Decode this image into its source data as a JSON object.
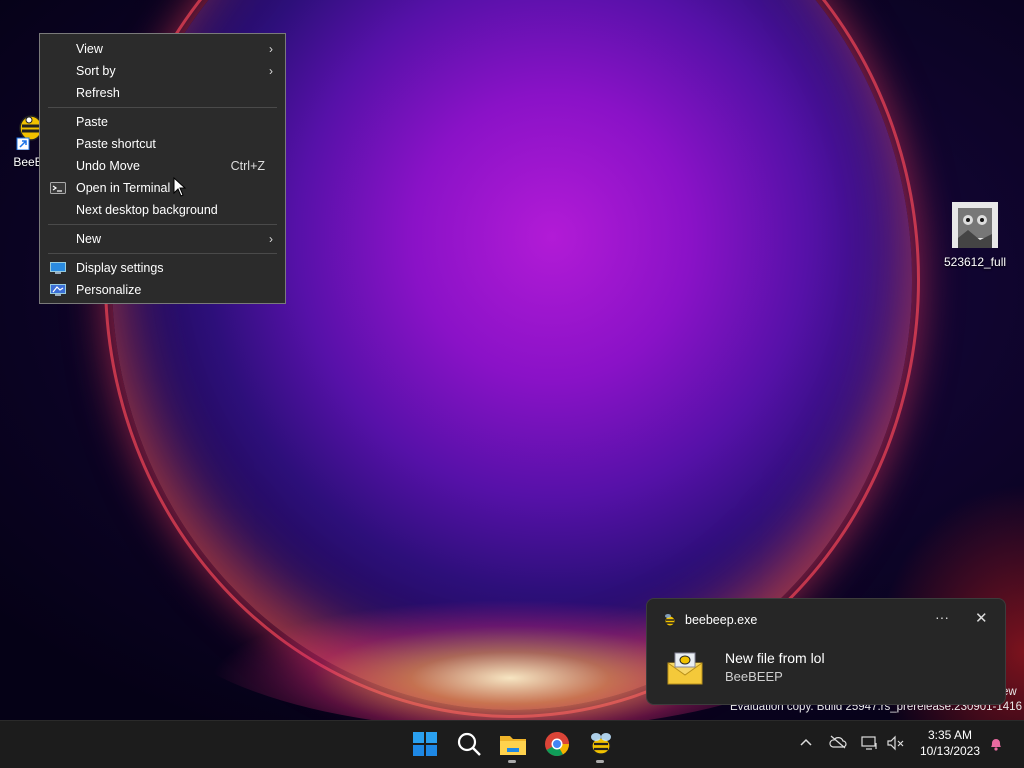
{
  "desktop": {
    "icons": [
      {
        "label": "BeeB",
        "icon": "beebeep-icon"
      },
      {
        "label": "523612_full",
        "icon": "image-file-icon"
      }
    ]
  },
  "context_menu": {
    "items": [
      {
        "label": "View",
        "submenu": true
      },
      {
        "label": "Sort by",
        "submenu": true
      },
      {
        "label": "Refresh"
      },
      {
        "label": "Paste"
      },
      {
        "label": "Paste shortcut"
      },
      {
        "label": "Undo Move",
        "shortcut": "Ctrl+Z"
      },
      {
        "label": "Open in Terminal",
        "icon": "terminal-icon"
      },
      {
        "label": "Next desktop background"
      },
      {
        "label": "New",
        "submenu": true
      },
      {
        "label": "Display settings",
        "icon": "display-icon"
      },
      {
        "label": "Personalize",
        "icon": "personalize-icon"
      }
    ]
  },
  "watermark": {
    "line1": "ew",
    "line2": "Evaluation copy. Build 25947.rs_prerelease.230901-1416"
  },
  "toast": {
    "app_name": "beebeep.exe",
    "more": "···",
    "close": "✕",
    "title": "New file from lol",
    "subtitle": "BeeBEEP"
  },
  "taskbar": {
    "apps": [
      "start-icon",
      "search-icon",
      "file-explorer-icon",
      "chrome-icon",
      "beebeep-icon"
    ],
    "time": "3:35 AM",
    "date": "10/13/2023"
  },
  "colors": {
    "menu_bg": "#2b2b2b",
    "taskbar_bg": "#1c1c1c",
    "accent": "#0078d4"
  }
}
